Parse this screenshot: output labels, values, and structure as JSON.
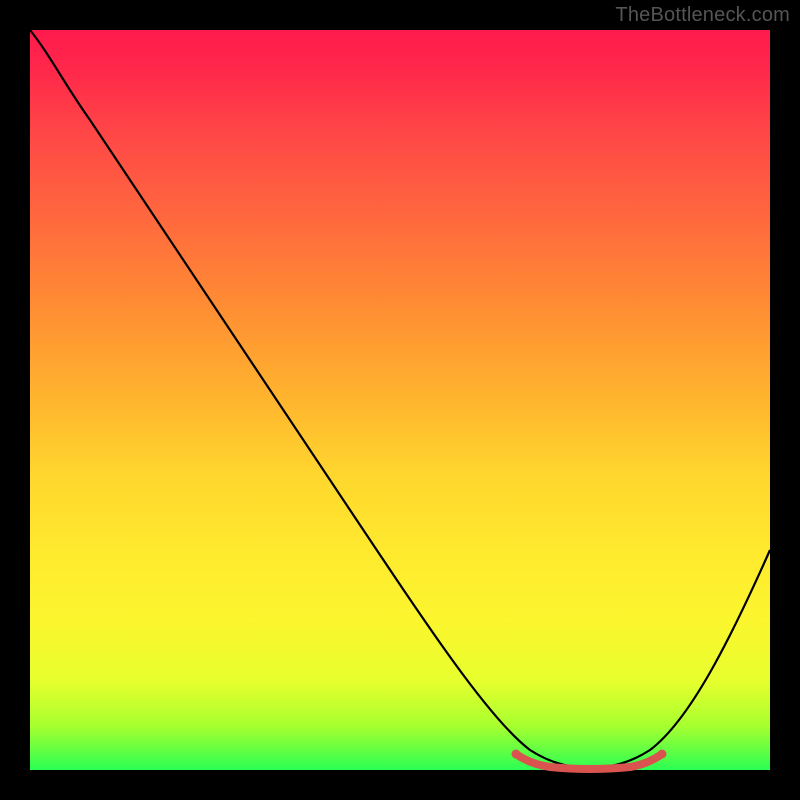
{
  "watermark": "TheBottleneck.com",
  "chart_data": {
    "type": "line",
    "title": "",
    "xlabel": "",
    "ylabel": "",
    "xlim": [
      0,
      100
    ],
    "ylim": [
      0,
      100
    ],
    "series": [
      {
        "name": "bottleneck-curve",
        "x": [
          0,
          3,
          8,
          15,
          25,
          40,
          55,
          62,
          66,
          70,
          74,
          78,
          82,
          88,
          94,
          100
        ],
        "y": [
          100,
          97,
          92,
          84,
          72,
          52,
          30,
          16,
          8,
          3,
          1,
          1,
          3,
          12,
          28,
          48
        ]
      },
      {
        "name": "optimal-marker",
        "x": [
          66,
          68,
          70,
          72,
          74,
          76,
          78,
          80,
          82
        ],
        "y": [
          2,
          1.2,
          0.8,
          0.6,
          0.6,
          0.6,
          0.8,
          1.2,
          2
        ]
      }
    ],
    "colors": {
      "curve": "#000000",
      "marker": "#d9534f",
      "gradient_top": "#ff1a4d",
      "gradient_bottom": "#2aff53"
    }
  }
}
